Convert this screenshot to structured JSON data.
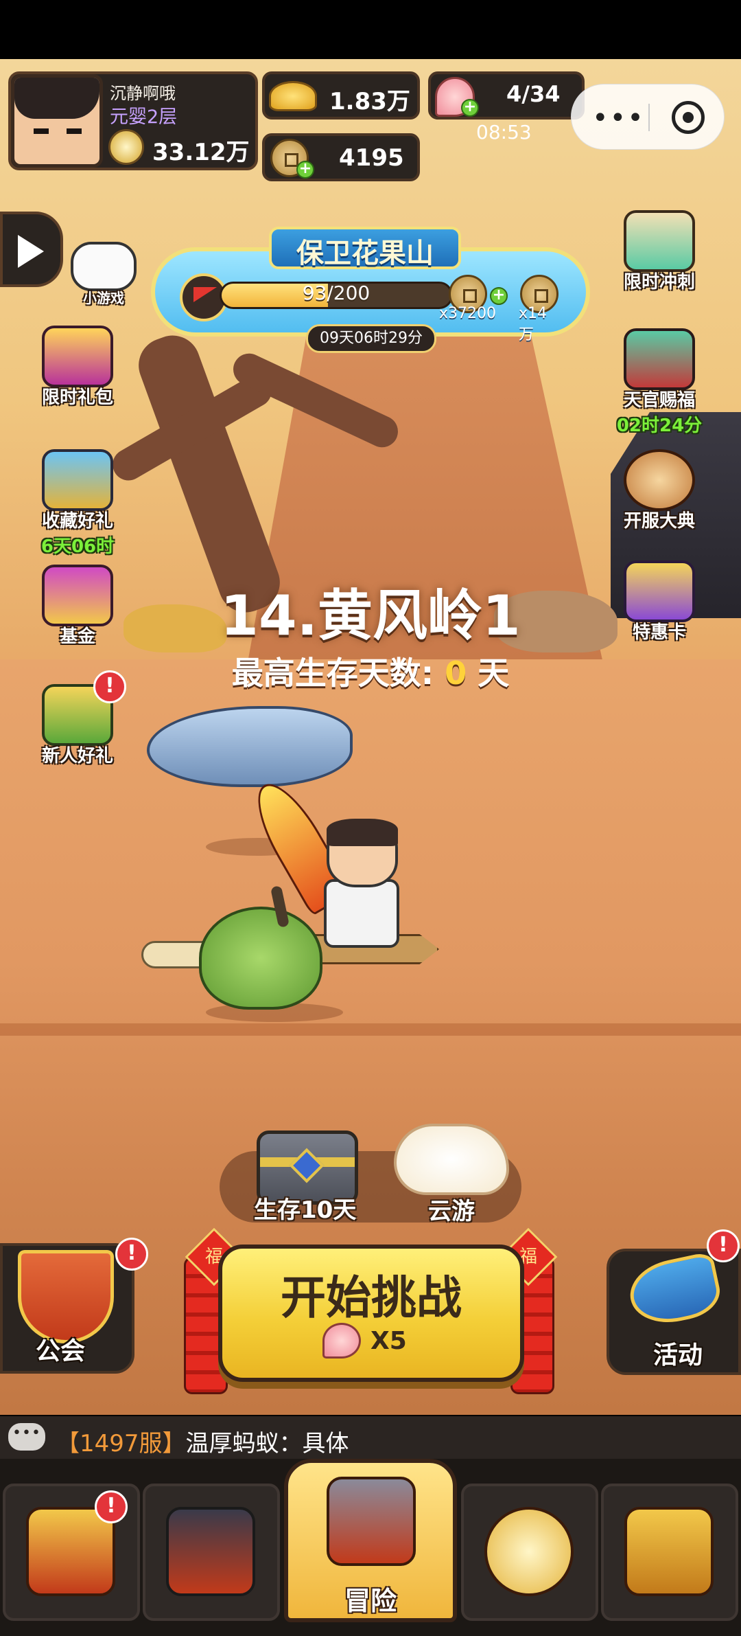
{
  "player": {
    "name": "沉静啊哦",
    "realm": "元婴2层",
    "power": "33.12万"
  },
  "resources": {
    "gold": "1.83万",
    "coins": "4195",
    "peaches": "4/34",
    "refill_timer": "08:53"
  },
  "event": {
    "title": "保卫花果山",
    "progress_text": "93/200",
    "progress_fraction": 0.465,
    "reward1_label": "x37200",
    "reward2_label": "x14万",
    "countdown": "09天06时29分"
  },
  "left_icons": [
    {
      "label": "小游戏"
    },
    {
      "label": "限时礼包"
    },
    {
      "label": "收藏好礼",
      "sub": "6天06时"
    },
    {
      "label": "基金"
    },
    {
      "label": "新人好礼",
      "alert": "!"
    }
  ],
  "right_icons": [
    {
      "label": "限时冲刺"
    },
    {
      "label": "天官赐福",
      "sub": "02时24分"
    },
    {
      "label": "开服大典"
    },
    {
      "label": "特惠卡"
    }
  ],
  "stage": {
    "title": "14.黄风岭1",
    "survive_label": "最高生存天数:",
    "survive_days": "0",
    "survive_unit": "天"
  },
  "tray": {
    "chest_label": "生存10天",
    "cloud_label": "云游"
  },
  "start": {
    "label": "开始挑战",
    "cost": "X5",
    "fu": "福"
  },
  "guild": {
    "label": "公会",
    "alert": "!"
  },
  "activity": {
    "label": "活动",
    "alert": "!"
  },
  "chat": {
    "server": "【1497服】",
    "message": "温厚蚂蚁：具体"
  },
  "nav": {
    "active_label": "冒险",
    "home_alert": "!"
  },
  "colors": {
    "accent_gold": "#f4cf38",
    "alert_red": "#e3343a",
    "timer_green": "#7cf03a",
    "realm_purple": "#c7a2ff"
  }
}
